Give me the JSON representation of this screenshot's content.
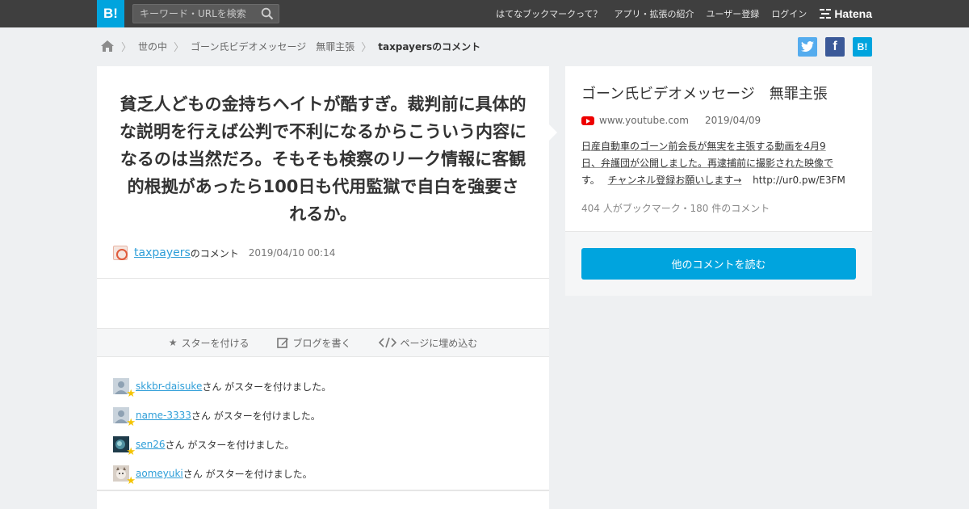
{
  "header": {
    "logo_text": "B!",
    "search_placeholder": "キーワード・URLを検索",
    "nav": [
      "はてなブックマークって？",
      "アプリ・拡張の紹介",
      "ユーザー登録",
      "ログイン"
    ],
    "hatena_label": "Hatena"
  },
  "breadcrumb": {
    "items": [
      "世の中",
      "ゴーン氏ビデオメッセージ　無罪主張"
    ],
    "current": "taxpayersのコメント"
  },
  "share": {
    "facebook_label": "f",
    "hatebu_label": "B!"
  },
  "comment": {
    "text": "貧乏人どもの金持ちヘイトが酷すぎ。裁判前に具体的な説明を行えば公判で不利になるからこういう内容になるのは当然だろ。そもそも検察のリーク情報に客観的根拠があったら100日も代用監獄で自白を強要されるか。",
    "user": "taxpayers",
    "user_suffix": "のコメント",
    "timestamp": "2019/04/10 00:14"
  },
  "actions": {
    "star": "スターを付ける",
    "blog": "ブログを書く",
    "embed": "ページに埋め込む"
  },
  "stars": [
    {
      "name": "skkbr-daisuke",
      "text": "さん がスターを付けました。"
    },
    {
      "name": "name-3333",
      "text": "さん がスターを付けました。"
    },
    {
      "name": "sen26",
      "text": "さん がスターを付けました。"
    },
    {
      "name": "aomeyuki",
      "text": "さん がスターを付けました。"
    }
  ],
  "entry": {
    "title": "ゴーン氏ビデオメッセージ　無罪主張",
    "domain": "www.youtube.com",
    "date": "2019/04/09",
    "desc_line1": "日産自動車のゴーン前会長が無実を主張する動画を4月9",
    "desc_line2": "日、弁護団が公開しました。再逮捕前に撮影された映像で",
    "desc_line3a": "す。",
    "desc_line3b": "チャンネル登録お願いします→",
    "desc_url": "http://ur0.pw/E3FM",
    "count": "404 人がブックマーク・180 件のコメント",
    "button": "他のコメントを読む"
  },
  "colors": {
    "brand": "#00a4de",
    "link": "#2e9ed8",
    "star": "#f5c400"
  }
}
